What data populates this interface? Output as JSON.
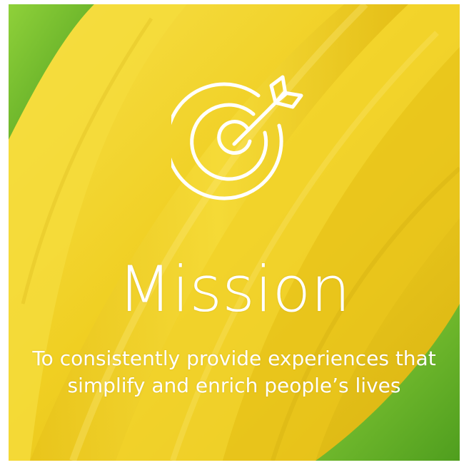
{
  "slide": {
    "icon": "target-with-arrow-icon",
    "title": "Mission",
    "statement_line1": "To consistently provide experiences that",
    "statement_line2": "simplify and enrich people’s lives"
  },
  "colors": {
    "banana_yellow": "#f2d22a",
    "banana_shadow": "#c9a40d",
    "leaf_green": "#6fbf2a",
    "text": "#ffffff"
  }
}
